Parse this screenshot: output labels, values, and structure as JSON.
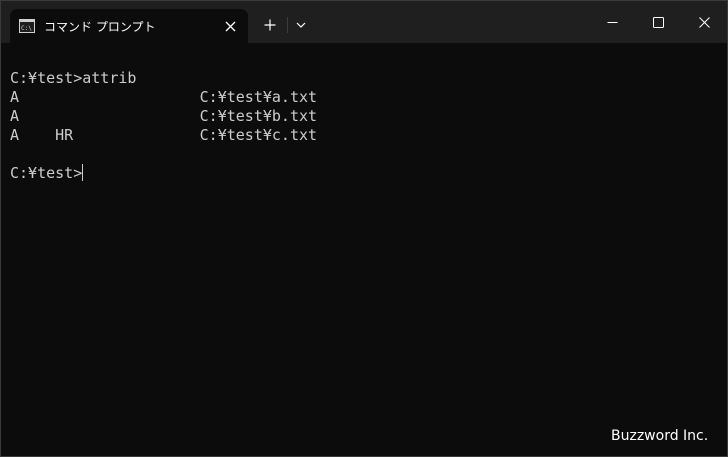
{
  "window": {
    "tab_title": "コマンド プロンプト",
    "tab_icon": "console-icon",
    "close_tab_icon": "close-icon",
    "new_tab_icon": "plus-icon",
    "dropdown_icon": "chevron-down-icon",
    "minimize_icon": "minimize-icon",
    "maximize_icon": "maximize-icon",
    "close_window_icon": "close-icon"
  },
  "console": {
    "lines": [
      "",
      "C:¥test>attrib",
      "A                    C:¥test¥a.txt",
      "A                    C:¥test¥b.txt",
      "A    HR              C:¥test¥c.txt",
      "",
      "C:¥test>"
    ]
  },
  "watermark": "Buzzword Inc.",
  "colors": {
    "background": "#0c0c0c",
    "titlebar": "#1f1f1f",
    "text": "#cccccc"
  }
}
